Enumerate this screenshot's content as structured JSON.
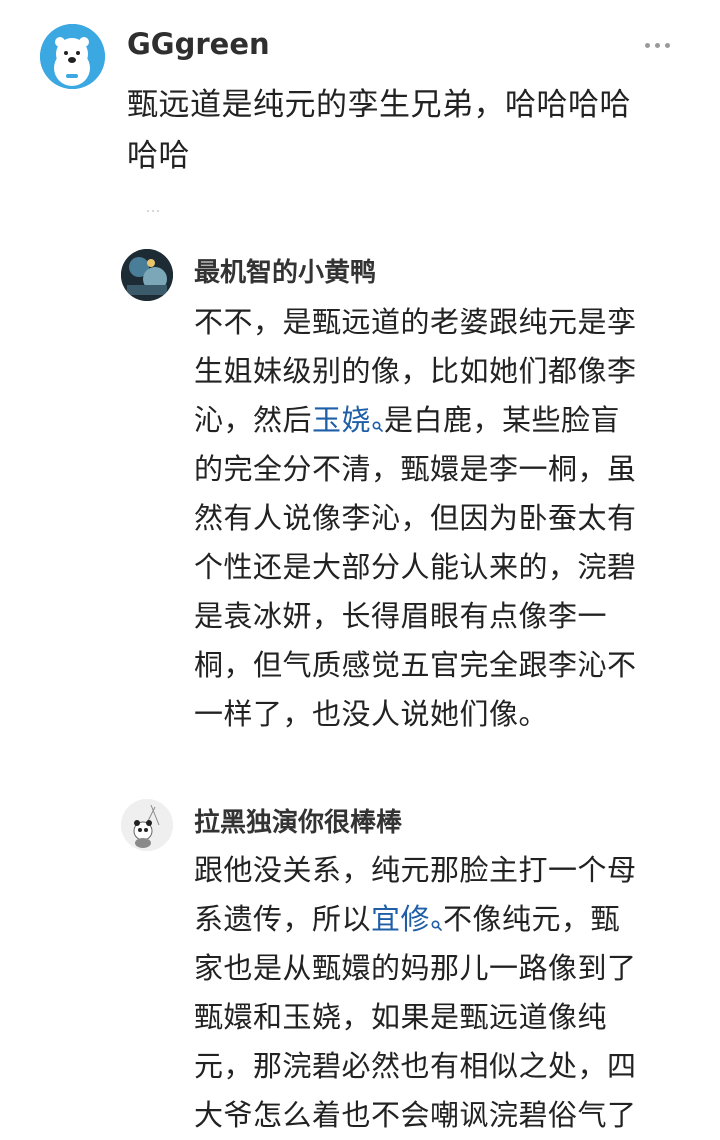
{
  "comments": [
    {
      "username": "GGgreen",
      "lines": [
        "甄远道是纯元的孪生兄弟，哈哈哈哈",
        "哈哈"
      ]
    },
    {
      "username": "最机智的小黄鸭",
      "lines": [
        "不不，是甄远道的老婆跟纯元是孪",
        "生姐妹级别的像，比如她们都像李",
        "沁，然后",
        "玉娆",
        "是白鹿，某些脸盲",
        "的完全分不清，甄嬛是李一桐，虽",
        "然有人说像李沁，但因为卧蚕太有",
        "个性还是大部分人能认来的，浣碧",
        "是袁冰妍，长得眉眼有点像李一",
        "桐，但气质感觉五官完全跟李沁不",
        "一样了，也没人说她们像。"
      ]
    },
    {
      "username": "拉黑独演你很棒棒",
      "lines": [
        "跟他没关系，纯元那脸主打一个母",
        "系遗传，所以",
        "宜修",
        "不像纯元，甄",
        "家也是从甄嬛的妈那儿一路像到了",
        "甄嬛和玉娆，如果是甄远道像纯",
        "元，那浣碧必然也有相似之处，四",
        "大爷怎么着也不会嘲讽浣碧俗气了"
      ]
    }
  ],
  "icons": {
    "more": "more-horizontal-icon",
    "search": "search-icon"
  },
  "colors": {
    "link": "#1f5fa8",
    "username": "#333333",
    "text": "#222222"
  }
}
